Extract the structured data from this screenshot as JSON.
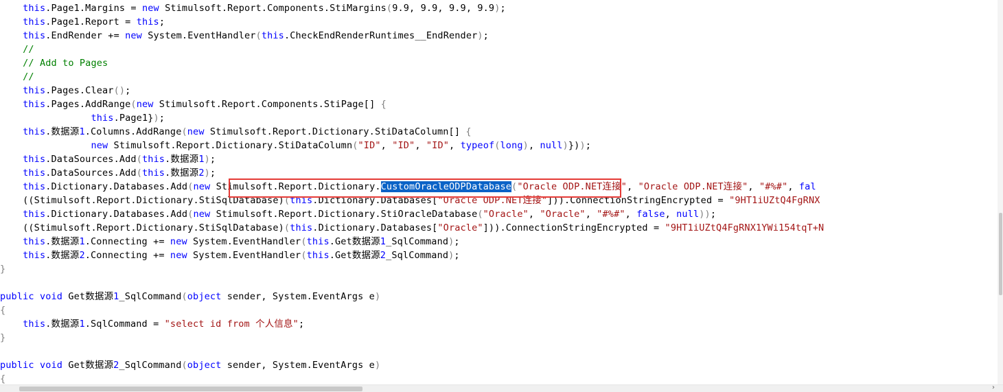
{
  "editor": {
    "lines": [
      [
        [
          "kw",
          "    this"
        ],
        [
          "pl",
          ".Page1.Margins = "
        ],
        [
          "kw",
          "new"
        ],
        [
          "pl",
          " Stimulsoft.Report.Components.StiMargins"
        ],
        [
          "pn",
          "("
        ],
        [
          "pl",
          "9.9, 9.9, 9.9, 9.9"
        ],
        [
          "pn",
          ")"
        ],
        [
          "pl",
          ";"
        ]
      ],
      [
        [
          "kw",
          "    this"
        ],
        [
          "pl",
          ".Page1.Report = "
        ],
        [
          "kw",
          "this"
        ],
        [
          "pl",
          ";"
        ]
      ],
      [
        [
          "kw",
          "    this"
        ],
        [
          "pl",
          ".EndRender += "
        ],
        [
          "kw",
          "new"
        ],
        [
          "pl",
          " System.EventHandler"
        ],
        [
          "pn",
          "("
        ],
        [
          "kw",
          "this"
        ],
        [
          "pl",
          ".CheckEndRenderRuntimes__EndRender"
        ],
        [
          "pn",
          ")"
        ],
        [
          "pl",
          ";"
        ]
      ],
      [
        [
          "cm",
          "    //"
        ]
      ],
      [
        [
          "cm",
          "    // Add to Pages"
        ]
      ],
      [
        [
          "cm",
          "    //"
        ]
      ],
      [
        [
          "kw",
          "    this"
        ],
        [
          "pl",
          ".Pages.Clear"
        ],
        [
          "pn",
          "()"
        ],
        [
          "pl",
          ";"
        ]
      ],
      [
        [
          "kw",
          "    this"
        ],
        [
          "pl",
          ".Pages.AddRange"
        ],
        [
          "pn",
          "("
        ],
        [
          "kw",
          "new"
        ],
        [
          "pl",
          " Stimulsoft.Report.Components.StiPage[] "
        ],
        [
          "pn",
          "{"
        ]
      ],
      [
        [
          "kw",
          "                this"
        ],
        [
          "pl",
          ".Page1}"
        ],
        [
          "pn",
          ")"
        ],
        [
          "pl",
          ";"
        ]
      ],
      [
        [
          "kw",
          "    this"
        ],
        [
          "pl",
          ".数据源"
        ],
        [
          "kw",
          "1"
        ],
        [
          "pl",
          ".Columns.AddRange"
        ],
        [
          "pn",
          "("
        ],
        [
          "kw",
          "new"
        ],
        [
          "pl",
          " Stimulsoft.Report.Dictionary.StiDataColumn[] "
        ],
        [
          "pn",
          "{"
        ]
      ],
      [
        [
          "kw",
          "                new"
        ],
        [
          "pl",
          " Stimulsoft.Report.Dictionary.StiDataColumn"
        ],
        [
          "pn",
          "("
        ],
        [
          "str",
          "\"ID\""
        ],
        [
          "pl",
          ", "
        ],
        [
          "str",
          "\"ID\""
        ],
        [
          "pl",
          ", "
        ],
        [
          "str",
          "\"ID\""
        ],
        [
          "pl",
          ", "
        ],
        [
          "kw",
          "typeof"
        ],
        [
          "pn",
          "("
        ],
        [
          "kw",
          "long"
        ],
        [
          "pn",
          ")"
        ],
        [
          "pl",
          ", "
        ],
        [
          "kw",
          "null"
        ],
        [
          "pn",
          ")"
        ],
        [
          "pl",
          "})"
        ],
        [
          "pn",
          ")"
        ],
        [
          "pl",
          ";"
        ]
      ],
      [
        [
          "kw",
          "    this"
        ],
        [
          "pl",
          ".DataSources.Add"
        ],
        [
          "pn",
          "("
        ],
        [
          "kw",
          "this"
        ],
        [
          "pl",
          ".数据源"
        ],
        [
          "kw",
          "1"
        ],
        [
          "pn",
          ")"
        ],
        [
          "pl",
          ";"
        ]
      ],
      [
        [
          "kw",
          "    this"
        ],
        [
          "pl",
          ".DataSources.Add"
        ],
        [
          "pn",
          "("
        ],
        [
          "kw",
          "this"
        ],
        [
          "pl",
          ".数据源"
        ],
        [
          "kw",
          "2"
        ],
        [
          "pn",
          ")"
        ],
        [
          "pl",
          ";"
        ]
      ],
      [
        [
          "kw",
          "    this"
        ],
        [
          "pl",
          ".Dictionary.Databases.Add"
        ],
        [
          "pn",
          "("
        ],
        [
          "kw",
          "new"
        ],
        [
          "pl",
          " Stimulsoft.Report.Dictionary."
        ],
        [
          "sel",
          "CustomOracleODPDatabase"
        ],
        [
          "pn",
          "("
        ],
        [
          "str",
          "\"Oracle ODP.NET连接\""
        ],
        [
          "pl",
          ", "
        ],
        [
          "str",
          "\"Oracle ODP.NET连接\""
        ],
        [
          "pl",
          ", "
        ],
        [
          "str",
          "\"#%#\""
        ],
        [
          "pl",
          ", "
        ],
        [
          "kw",
          "fal"
        ]
      ],
      [
        [
          "pl",
          "    ((Stimulsoft.Report.Dictionary.StiSqlDatabase)"
        ],
        [
          "pn",
          "("
        ],
        [
          "kw",
          "this"
        ],
        [
          "pl",
          ".Dictionary.Databases["
        ],
        [
          "str",
          "\"Oracle ODP.NET连接\""
        ],
        [
          "pl",
          "]))"
        ],
        [
          "pl",
          ".ConnectionStringEncrypted = "
        ],
        [
          "str",
          "\"9HT1iUZtQ4FgRNX"
        ]
      ],
      [
        [
          "kw",
          "    this"
        ],
        [
          "pl",
          ".Dictionary.Databases.Add"
        ],
        [
          "pn",
          "("
        ],
        [
          "kw",
          "new"
        ],
        [
          "pl",
          " Stimulsoft.Report.Dictionary.StiOracleDatabase"
        ],
        [
          "pn",
          "("
        ],
        [
          "str",
          "\"Oracle\""
        ],
        [
          "pl",
          ", "
        ],
        [
          "str",
          "\"Oracle\""
        ],
        [
          "pl",
          ", "
        ],
        [
          "str",
          "\"#%#\""
        ],
        [
          "pl",
          ", "
        ],
        [
          "kw",
          "false"
        ],
        [
          "pl",
          ", "
        ],
        [
          "kw",
          "null"
        ],
        [
          "pn",
          "))"
        ],
        [
          "pl",
          ";"
        ]
      ],
      [
        [
          "pl",
          "    ((Stimulsoft.Report.Dictionary.StiSqlDatabase)"
        ],
        [
          "pn",
          "("
        ],
        [
          "kw",
          "this"
        ],
        [
          "pl",
          ".Dictionary.Databases["
        ],
        [
          "str",
          "\"Oracle\""
        ],
        [
          "pl",
          "]))"
        ],
        [
          "pl",
          ".ConnectionStringEncrypted = "
        ],
        [
          "str",
          "\"9HT1iUZtQ4FgRNX1YWi154tqT+N"
        ]
      ],
      [
        [
          "kw",
          "    this"
        ],
        [
          "pl",
          ".数据源"
        ],
        [
          "kw",
          "1"
        ],
        [
          "pl",
          ".Connecting += "
        ],
        [
          "kw",
          "new"
        ],
        [
          "pl",
          " System.EventHandler"
        ],
        [
          "pn",
          "("
        ],
        [
          "kw",
          "this"
        ],
        [
          "pl",
          ".Get数据源"
        ],
        [
          "kw",
          "1"
        ],
        [
          "pl",
          "_SqlCommand"
        ],
        [
          "pn",
          ")"
        ],
        [
          "pl",
          ";"
        ]
      ],
      [
        [
          "kw",
          "    this"
        ],
        [
          "pl",
          ".数据源"
        ],
        [
          "kw",
          "2"
        ],
        [
          "pl",
          ".Connecting += "
        ],
        [
          "kw",
          "new"
        ],
        [
          "pl",
          " System.EventHandler"
        ],
        [
          "pn",
          "("
        ],
        [
          "kw",
          "this"
        ],
        [
          "pl",
          ".Get数据源"
        ],
        [
          "kw",
          "2"
        ],
        [
          "pl",
          "_SqlCommand"
        ],
        [
          "pn",
          ")"
        ],
        [
          "pl",
          ";"
        ]
      ],
      [
        [
          "pn",
          "}"
        ]
      ],
      [],
      [
        [
          "kw",
          "public"
        ],
        [
          "pl",
          " "
        ],
        [
          "kw",
          "void"
        ],
        [
          "pl",
          " Get数据源"
        ],
        [
          "kw",
          "1"
        ],
        [
          "pl",
          "_SqlCommand"
        ],
        [
          "pn",
          "("
        ],
        [
          "kw",
          "object"
        ],
        [
          "pl",
          " sender, System.EventArgs e"
        ],
        [
          "pn",
          ")"
        ]
      ],
      [
        [
          "pn",
          "{"
        ]
      ],
      [
        [
          "kw",
          "    this"
        ],
        [
          "pl",
          ".数据源"
        ],
        [
          "kw",
          "1"
        ],
        [
          "pl",
          ".SqlCommand = "
        ],
        [
          "str",
          "\"select id from 个人信息\""
        ],
        [
          "pl",
          ";"
        ]
      ],
      [
        [
          "pn",
          "}"
        ]
      ],
      [],
      [
        [
          "kw",
          "public"
        ],
        [
          "pl",
          " "
        ],
        [
          "kw",
          "void"
        ],
        [
          "pl",
          " Get数据源"
        ],
        [
          "kw",
          "2"
        ],
        [
          "pl",
          "_SqlCommand"
        ],
        [
          "pn",
          "("
        ],
        [
          "kw",
          "object"
        ],
        [
          "pl",
          " sender, System.EventArgs e"
        ],
        [
          "pn",
          ")"
        ]
      ],
      [
        [
          "pn",
          "{"
        ]
      ]
    ]
  },
  "colors": {
    "keyword": "#0000ff",
    "string": "#a31515",
    "comment": "#008000",
    "selection": "#0b63c7",
    "highlight_box": "#e53935"
  },
  "scrollbar": {
    "right_arrow": "›"
  }
}
